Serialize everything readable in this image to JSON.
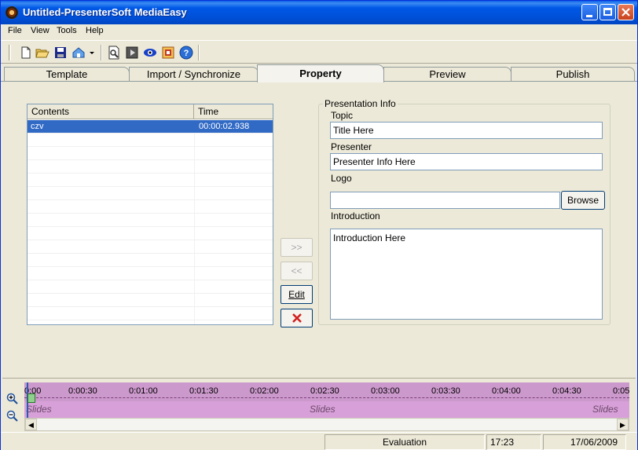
{
  "window": {
    "title": "Untitled-PresenterSoft MediaEasy"
  },
  "menu": [
    "File",
    "View",
    "Tools",
    "Help"
  ],
  "toolbar": {
    "icons": [
      "new-document-icon",
      "open-folder-icon",
      "save-icon",
      "home-dropdown-icon",
      "preview-page-icon",
      "media-icon",
      "eye-icon",
      "publish-icon",
      "help-icon"
    ]
  },
  "tabs": [
    {
      "label": "Template",
      "active": false
    },
    {
      "label": "Import / Synchronize",
      "active": false
    },
    {
      "label": "Property",
      "active": true
    },
    {
      "label": "Preview",
      "active": false
    },
    {
      "label": "Publish",
      "active": false
    }
  ],
  "listview": {
    "columns": [
      "Contents",
      "Time"
    ],
    "rows": [
      {
        "contents": "czv",
        "time": "00:00:02.938",
        "selected": true
      }
    ]
  },
  "middle_buttons": {
    "add": ">>",
    "remove": "<<",
    "edit": "Edit",
    "delete": "✕"
  },
  "presentation_info": {
    "group_title": "Presentation Info",
    "topic_label": "Topic",
    "topic_value": "Title Here",
    "presenter_label": "Presenter",
    "presenter_value": "Presenter Info Here",
    "logo_label": "Logo",
    "logo_value": "",
    "browse_label": "Browse",
    "introduction_label": "Introduction",
    "introduction_value": "Introduction Here"
  },
  "timeline": {
    "ticks": [
      "0:00",
      "0:00:30",
      "0:01:00",
      "0:01:30",
      "0:02:00",
      "0:02:30",
      "0:03:00",
      "0:03:30",
      "0:04:00",
      "0:04:30",
      "0:05"
    ],
    "track_label": "Slides"
  },
  "statusbar": {
    "mode": "Evaluation",
    "time": "17:23",
    "date": "17/06/2009"
  },
  "colors": {
    "titlebar": "#0058e6",
    "selection": "#316ac5",
    "timeline_ruler": "#cc99cc",
    "timeline_track": "#d8a0d8"
  }
}
